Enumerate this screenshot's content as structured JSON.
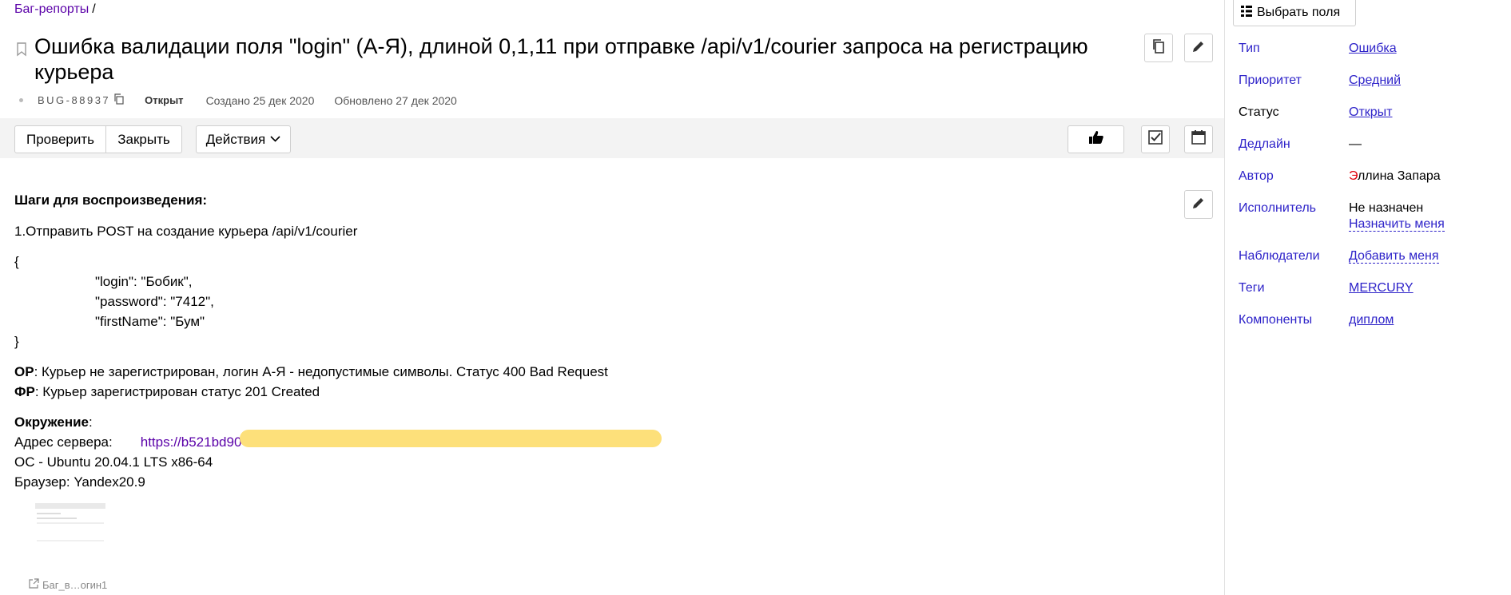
{
  "breadcrumb": {
    "label": "Баг-репорты",
    "sep": "/"
  },
  "issue": {
    "title": "Ошибка валидации поля \"login\" (А-Я), длиной 0,1,11 при отправке /api/v1/courier запроса на регистрацию курьера",
    "key": "BUG-88937",
    "status": "Открыт",
    "created": "Создано 25 дек 2020",
    "updated": "Обновлено 27 дек 2020"
  },
  "toolbar": {
    "check_label": "Проверить",
    "close_label": "Закрыть",
    "actions_label": "Действия"
  },
  "description": {
    "steps_heading": "Шаги для воспроизведения:",
    "step1": "1.Отправить POST на создание курьера /api/v1/courier",
    "brace_open": "{",
    "body_lines": [
      "\"login\": \"Бобик\",",
      "\"password\": \"7412\",",
      "\"firstName\": \"Бум\""
    ],
    "brace_close": "}",
    "expected_label": "ОР",
    "expected_text": ": Курьер не зарегистрирован, логин А-Я - недопустимые символы. Статус 400 Bad Request",
    "actual_label": "ФР",
    "actual_text": ": Курьер зарегистрирован статус 201 Created",
    "env_label": "Окружение",
    "env_colon": ":",
    "server_label": "Адрес сервера:",
    "server_url": "https://b521bd90-e",
    "os": "ОС - Ubuntu 20.04.1 LTS x86-64",
    "browser": "Браузер: Yandex20.9",
    "attachment_name": "Баг_в…огин1"
  },
  "sidebar": {
    "fields_button": "Выбрать поля",
    "type": {
      "label": "Тип",
      "value": "Ошибка"
    },
    "priority": {
      "label": "Приоритет",
      "value": "Средний"
    },
    "status": {
      "label": "Статус",
      "value": "Открыт"
    },
    "deadline": {
      "label": "Дедлайн",
      "value": "—"
    },
    "author": {
      "label": "Автор",
      "first_letter": "Э",
      "rest": "ллина Запара"
    },
    "assignee": {
      "label": "Исполнитель",
      "value": "Не назначен",
      "action": "Назначить меня"
    },
    "followers": {
      "label": "Наблюдатели",
      "action": "Добавить меня"
    },
    "tags": {
      "label": "Теги",
      "value": "MERCURY"
    },
    "components": {
      "label": "Компоненты",
      "value": "диплом"
    }
  },
  "colors": {
    "link": "#5a00a8",
    "sidebar_link": "#2e23c9",
    "toolbar_bg": "#f3f3f3",
    "redaction": "#fde07a",
    "author_accent": "#e0000a"
  }
}
